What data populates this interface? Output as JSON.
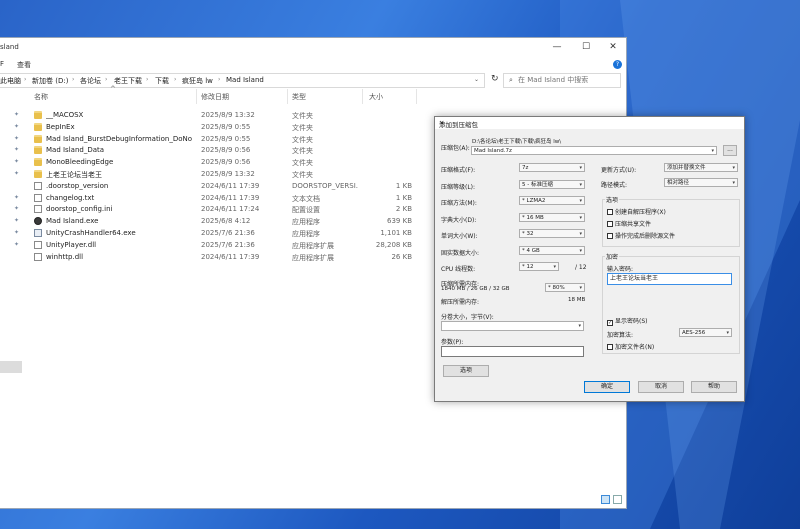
{
  "colors": {
    "accent": "#0078d7",
    "folder": "#e9c04c",
    "desktop": "#2a64c8"
  },
  "explorer": {
    "title": "sland",
    "ribbon_tabs": [
      "F",
      "查看"
    ],
    "breadcrumbs": [
      "此电脑",
      "新加卷 (D:)",
      "各论坛",
      "老王下载",
      "下载",
      "疯狂岛 lw",
      "Mad Island"
    ],
    "search_placeholder": "在 Mad Island 中搜索",
    "columns": {
      "name": "名称",
      "date": "修改日期",
      "type": "类型",
      "size": "大小"
    },
    "files": [
      {
        "name": "__MACOSX",
        "date": "2025/8/9 13:32",
        "type": "文件夹",
        "size": "",
        "icon": "folder-icon",
        "pinned": true
      },
      {
        "name": "BepInEx",
        "date": "2025/8/9 0:55",
        "type": "文件夹",
        "size": "",
        "icon": "folder-icon",
        "pinned": true
      },
      {
        "name": "Mad Island_BurstDebugInformation_DoNo...",
        "date": "2025/8/9 0:55",
        "type": "文件夹",
        "size": "",
        "icon": "folder-icon",
        "pinned": true
      },
      {
        "name": "Mad Island_Data",
        "date": "2025/8/9 0:56",
        "type": "文件夹",
        "size": "",
        "icon": "folder-icon",
        "pinned": true
      },
      {
        "name": "MonoBleedingEdge",
        "date": "2025/8/9 0:56",
        "type": "文件夹",
        "size": "",
        "icon": "folder-icon",
        "pinned": true
      },
      {
        "name": "上老王论坛当老王",
        "date": "2025/8/9 13:32",
        "type": "文件夹",
        "size": "",
        "icon": "folder-icon",
        "pinned": true
      },
      {
        "name": ".doorstop_version",
        "date": "2024/6/11 17:39",
        "type": "DOORSTOP_VERSI...",
        "size": "1 KB",
        "icon": "file-icon",
        "pinned": false
      },
      {
        "name": "changelog.txt",
        "date": "2024/6/11 17:39",
        "type": "文本文档",
        "size": "1 KB",
        "icon": "file-icon",
        "pinned": true
      },
      {
        "name": "doorstop_config.ini",
        "date": "2024/6/11 17:24",
        "type": "配置设置",
        "size": "2 KB",
        "icon": "file-icon",
        "pinned": true
      },
      {
        "name": "Mad Island.exe",
        "date": "2025/6/8 4:12",
        "type": "应用程序",
        "size": "639 KB",
        "icon": "exe-icon",
        "pinned": true
      },
      {
        "name": "UnityCrashHandler64.exe",
        "date": "2025/7/6 21:36",
        "type": "应用程序",
        "size": "1,101 KB",
        "icon": "app-icon",
        "pinned": true
      },
      {
        "name": "UnityPlayer.dll",
        "date": "2025/7/6 21:36",
        "type": "应用程序扩展",
        "size": "28,208 KB",
        "icon": "dll-icon",
        "pinned": true
      },
      {
        "name": "winhttp.dll",
        "date": "2024/6/11 17:39",
        "type": "应用程序扩展",
        "size": "26 KB",
        "icon": "dll-icon",
        "pinned": false
      }
    ]
  },
  "dialog": {
    "title": "添加到压缩包",
    "archive_label": "压缩包(A):",
    "archive_path": "D:\\各论坛\\老王下载\\下载\\疯狂岛 lw\\",
    "archive_name": "Mad Island.7z",
    "browse": "...",
    "fields": [
      {
        "label": "压缩格式(F):",
        "value": "7z",
        "extra": ""
      },
      {
        "label": "压缩等级(L):",
        "value": "5 - 标准压缩",
        "extra": ""
      },
      {
        "label": "压缩方法(M):",
        "value": "* LZMA2",
        "extra": ""
      },
      {
        "label": "字典大小(D):",
        "value": "* 16 MB",
        "extra": ""
      },
      {
        "label": "单词大小(W):",
        "value": "* 32",
        "extra": ""
      },
      {
        "label": "固实数据大小:",
        "value": "* 4 GB",
        "extra": ""
      },
      {
        "label": "CPU 线程数:",
        "value": "* 12",
        "extra": "/ 12"
      }
    ],
    "mem_compress_label": "压缩所需内存:",
    "mem_compress_detail": "1840 MB / 26 GB / 32 GB",
    "mem_compress_pct": "* 80%",
    "mem_compress_val": "",
    "mem_decompress_label": "解压所需内存:",
    "mem_decompress_val": "18 MB",
    "split_label": "分卷大小，字节(V):",
    "params_label": "参数(P):",
    "options_button": "选项",
    "update_label": "更新方式(U):",
    "update_value": "添加并替换文件",
    "path_label": "路径模式:",
    "path_value": "相对路径",
    "options_group": "选项",
    "options": [
      {
        "label": "创建自解压程序(X)",
        "checked": false
      },
      {
        "label": "压缩共享文件",
        "checked": false
      },
      {
        "label": "操作完成后删除源文件",
        "checked": false
      }
    ],
    "encrypt_group": "加密",
    "password_label": "输入密码:",
    "password_value": "上老王论坛当老王",
    "show_password": "显示密码(S)",
    "show_password_checked": true,
    "enc_method_label": "加密算法:",
    "enc_method_value": "AES-256",
    "encrypt_names": "加密文件名(N)",
    "encrypt_names_checked": false,
    "ok": "确定",
    "cancel": "取消",
    "help": "帮助"
  }
}
